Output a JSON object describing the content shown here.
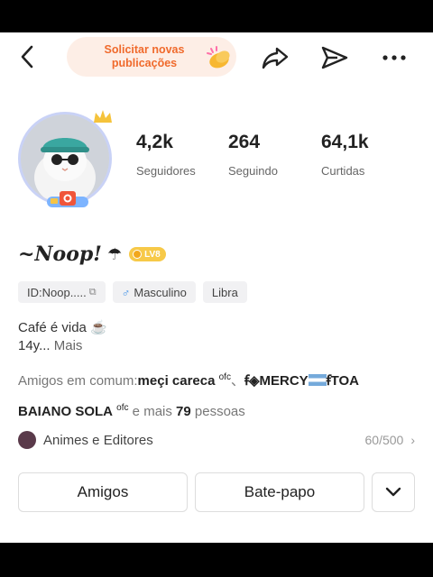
{
  "header": {
    "request_label": "Solicitar novas publicações",
    "icons": [
      "back-arrow-icon",
      "clapping-hands-icon",
      "share-icon",
      "send-icon",
      "more-icon"
    ]
  },
  "stats": [
    {
      "value": "4,2k",
      "label": "Seguidores"
    },
    {
      "value": "264",
      "label": "Seguindo"
    },
    {
      "value": "64,1k",
      "label": "Curtidas"
    }
  ],
  "profile": {
    "name": "~Noop!",
    "umbrella": "☂",
    "level": "LV8",
    "id_chip": "ID:Noop.....",
    "gender_symbol": "♂",
    "gender": "Masculino",
    "sign": "Libra",
    "bio_line1": "Café é vida ☕",
    "bio_line2": "14y...",
    "bio_more": "Mais"
  },
  "mutual": {
    "prefix": "Amigos em comum:",
    "friend1": "meçi careca",
    "friend1_sup": "ofc",
    "separator": "、",
    "friend2_a": "ꞙ◈MERCY",
    "friend2_b": "ꞙTOA",
    "friend3": "BAIANO SOLA",
    "friend3_sup": "ofc",
    "and_more": " e mais ",
    "count": "79",
    "people": " pessoas"
  },
  "group": {
    "name": "Animes e Editores",
    "count": "60/500",
    "chevron": "›"
  },
  "buttons": {
    "friends": "Amigos",
    "chat": "Bate-papo",
    "dropdown_icon": "chevron-down-icon"
  },
  "colors": {
    "accent_orange": "#f06a2c",
    "pill_bg": "#fdeee6",
    "level_badge": "#f7c948",
    "gender_blue": "#3a8ee6"
  }
}
